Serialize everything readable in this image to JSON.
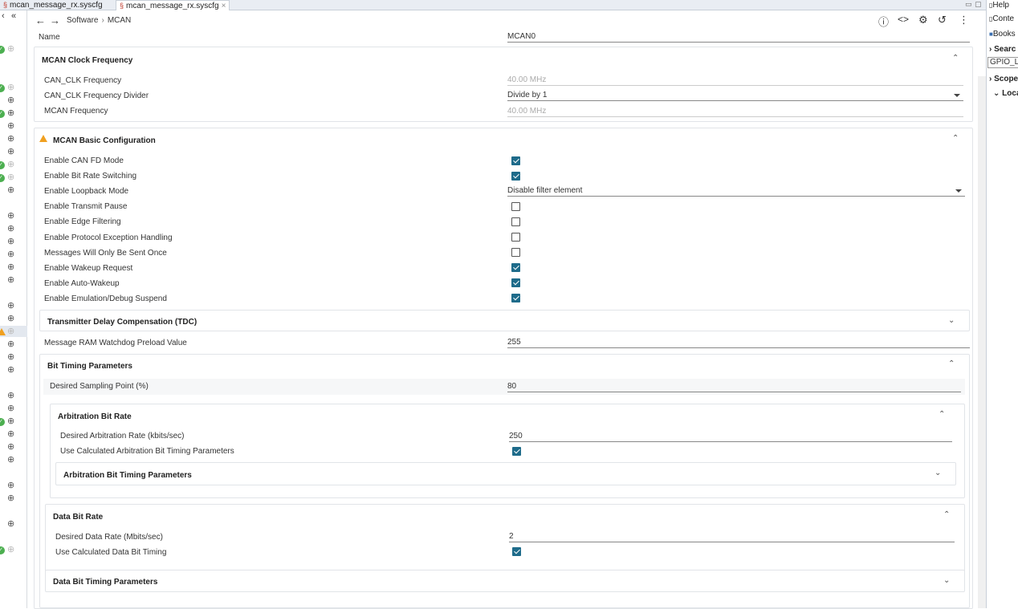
{
  "tabs": [
    {
      "label": "mcan_message_rx.syscfg",
      "active": false
    },
    {
      "label": "mcan_message_rx.syscfg",
      "active": true,
      "close": "×"
    }
  ],
  "nav": {
    "back_icon": "←",
    "forward_icon": "→",
    "left_collapse": "«",
    "left_back": "‹",
    "breadcrumb": [
      "Software",
      "MCAN"
    ],
    "tools": {
      "info": "ⓘ",
      "code": "<>",
      "chip": "⚙",
      "history": "↺",
      "more": "⋮"
    }
  },
  "header_row": {
    "label": "Name",
    "value": "MCAN0"
  },
  "clock_section": {
    "title": "MCAN Clock Frequency",
    "rows": [
      {
        "label": "CAN_CLK Frequency",
        "value": "40.00 MHz"
      },
      {
        "label": "CAN_CLK Frequency Divider",
        "value": "Divide by 1"
      },
      {
        "label": "MCAN Frequency",
        "value": "40.00 MHz"
      }
    ]
  },
  "basic_section": {
    "title": "MCAN Basic Configuration",
    "rows": [
      {
        "label": "Enable CAN FD Mode",
        "checked": true
      },
      {
        "label": "Enable Bit Rate Switching",
        "checked": true
      },
      {
        "label": "Enable Loopback Mode",
        "select": "Disable filter element"
      },
      {
        "label": "Enable Transmit Pause",
        "checked": false
      },
      {
        "label": "Enable Edge Filtering",
        "checked": false
      },
      {
        "label": "Enable Protocol Exception Handling",
        "checked": false
      },
      {
        "label": "Messages Will Only Be Sent Once",
        "checked": false
      },
      {
        "label": "Enable Wakeup Request",
        "checked": true
      },
      {
        "label": "Enable Auto-Wakeup",
        "checked": true
      },
      {
        "label": "Enable Emulation/Debug Suspend",
        "checked": true
      }
    ],
    "tdc_title": "Transmitter Delay Compensation (TDC)",
    "watchdog": {
      "label": "Message RAM Watchdog Preload Value",
      "value": "255"
    }
  },
  "bit_timing": {
    "title": "Bit Timing Parameters",
    "sampling": {
      "label": "Desired Sampling Point (%)",
      "value": "80"
    },
    "arb": {
      "title": "Arbitration Bit Rate",
      "rate_label": "Desired Arbitration Rate (kbits/sec)",
      "rate_value": "250",
      "use_calc_label": "Use Calculated Arbitration Bit Timing Parameters",
      "use_calc": true,
      "params_title": "Arbitration Bit Timing Parameters"
    },
    "data": {
      "title": "Data Bit Rate",
      "rate_label": "Desired Data Rate (Mbits/sec)",
      "rate_value": "2",
      "use_calc_label": "Use Calculated Data Bit Timing",
      "use_calc": true,
      "params_title": "Data Bit Timing Parameters"
    }
  },
  "right_pane": {
    "help": "Help",
    "contents": "Conte",
    "bookmarks": "Books",
    "search": "Searc",
    "search_value": "GPIO_L",
    "scope": "Scope",
    "local": "Local"
  },
  "colors": {
    "accent": "#1e6b8a",
    "warning": "#f0a020",
    "ok": "#4caf50"
  }
}
